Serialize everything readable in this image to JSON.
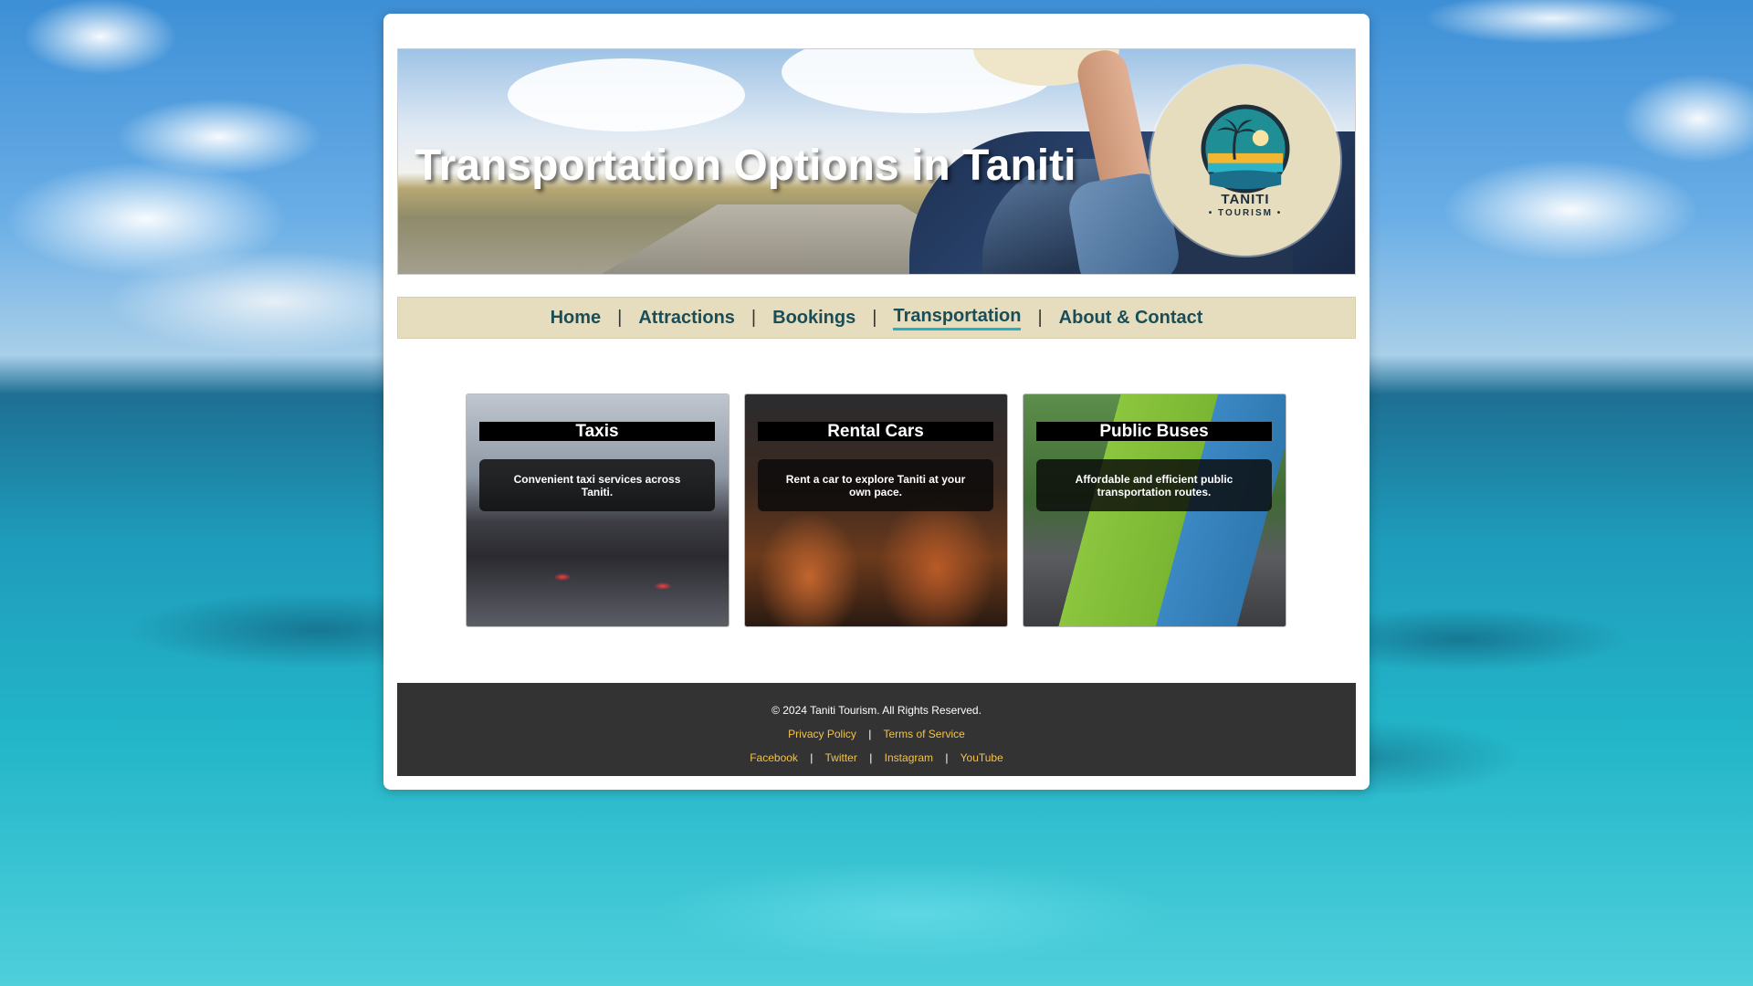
{
  "header": {
    "title": "Transportation Options in Taniti",
    "logo_name": "TANITI",
    "logo_sub": "• TOURISM •"
  },
  "nav": {
    "items": [
      {
        "label": "Home"
      },
      {
        "label": "Attractions"
      },
      {
        "label": "Bookings"
      },
      {
        "label": "Transportation",
        "active": true
      },
      {
        "label": "About & Contact"
      }
    ],
    "separator": "|"
  },
  "cards": [
    {
      "title": "Taxis",
      "description": "Convenient taxi services across Taniti."
    },
    {
      "title": "Rental Cars",
      "description": "Rent a car to explore Taniti at your own pace."
    },
    {
      "title": "Public Buses",
      "description": "Affordable and efficient public transportation routes."
    }
  ],
  "footer": {
    "copyright": "© 2024 Taniti Tourism. All Rights Reserved.",
    "legal_links": [
      {
        "label": "Privacy Policy"
      },
      {
        "label": "Terms of Service"
      }
    ],
    "social_links": [
      {
        "label": "Facebook"
      },
      {
        "label": "Twitter"
      },
      {
        "label": "Instagram"
      },
      {
        "label": "YouTube"
      }
    ],
    "separator": "|"
  },
  "colors": {
    "nav_background": "#e6ddbf",
    "nav_text": "#1b4d57",
    "active_underline": "#23b0c7",
    "footer_background": "#333333",
    "footer_link": "#f3c24a"
  }
}
